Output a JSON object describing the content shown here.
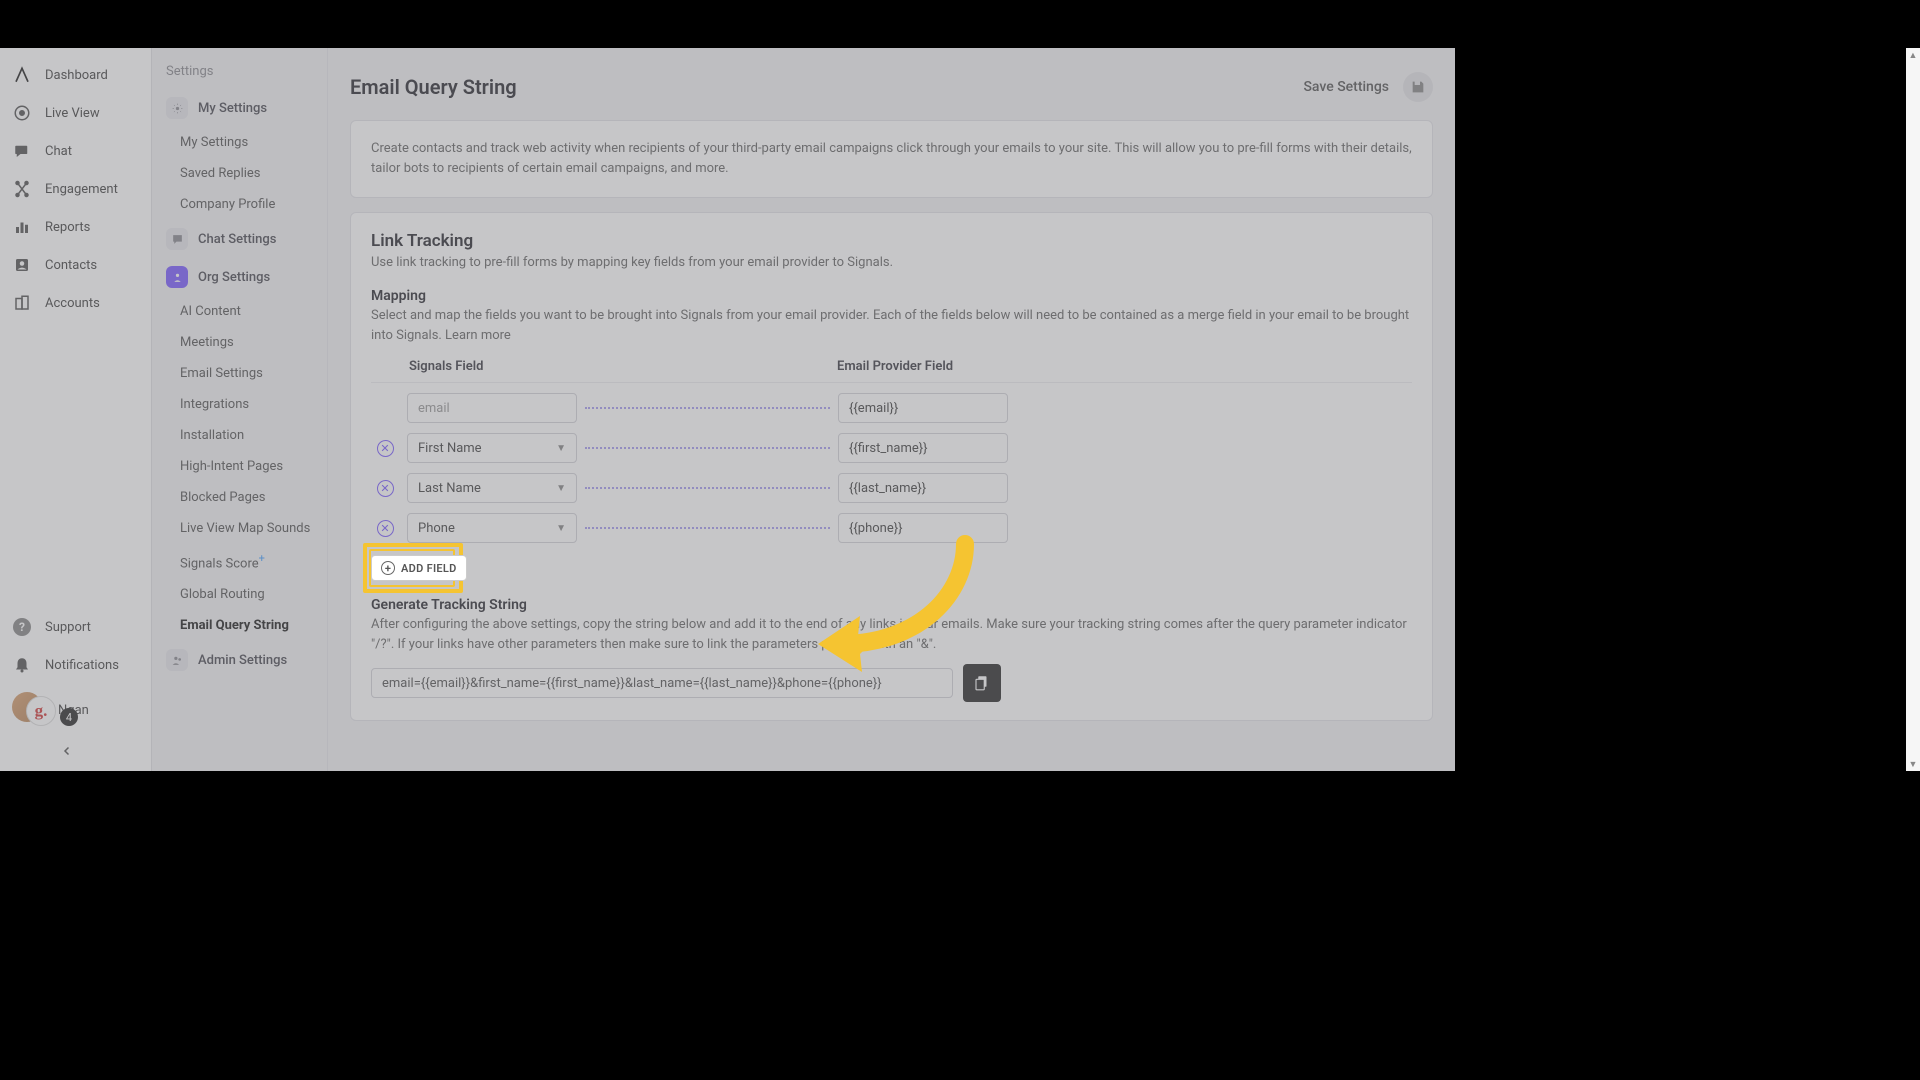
{
  "nav": {
    "items": [
      {
        "label": "Dashboard"
      },
      {
        "label": "Live View"
      },
      {
        "label": "Chat"
      },
      {
        "label": "Engagement"
      },
      {
        "label": "Reports"
      },
      {
        "label": "Contacts"
      },
      {
        "label": "Accounts"
      }
    ],
    "bottom": [
      {
        "label": "Support"
      },
      {
        "label": "Notifications"
      }
    ],
    "user": {
      "name": "Ngan",
      "badge": "4",
      "glyph": "g."
    }
  },
  "settings": {
    "heading": "Settings",
    "groups": {
      "my": {
        "label": "My Settings",
        "items": [
          "My Settings",
          "Saved Replies",
          "Company Profile"
        ]
      },
      "chat": {
        "label": "Chat Settings"
      },
      "org": {
        "label": "Org Settings",
        "items": [
          "AI Content",
          "Meetings",
          "Email Settings",
          "Integrations",
          "Installation",
          "High-Intent Pages",
          "Blocked Pages",
          "Live View Map Sounds",
          "Signals Score",
          "Global Routing",
          "Email Query String"
        ]
      },
      "admin": {
        "label": "Admin Settings"
      }
    }
  },
  "page": {
    "title": "Email Query String",
    "save_label": "Save Settings",
    "intro": "Create contacts and track web activity when recipients of your third-party email campaigns click through your emails to your site. This will allow you to pre-fill forms with their details, tailor bots to recipients of certain email campaigns, and more."
  },
  "link_tracking": {
    "title": "Link Tracking",
    "sub": "Use link tracking to pre-fill forms by mapping key fields from your email provider to Signals.",
    "mapping_title": "Mapping",
    "mapping_sub": "Select and map the fields you want to be brought into Signals from your email provider. Each of the fields below will need to be contained as a merge field in your email to be brought into Signals. Learn more",
    "col1": "Signals Field",
    "col2": "Email Provider Field",
    "rows": [
      {
        "signals": "email",
        "removable": false,
        "readonly": true,
        "provider": "{{email}}"
      },
      {
        "signals": "First Name",
        "removable": true,
        "readonly": false,
        "provider": "{{first_name}}"
      },
      {
        "signals": "Last Name",
        "removable": true,
        "readonly": false,
        "provider": "{{last_name}}"
      },
      {
        "signals": "Phone",
        "removable": true,
        "readonly": false,
        "provider": "{{phone}}"
      }
    ],
    "add_field": "ADD FIELD"
  },
  "generate": {
    "title": "Generate Tracking String",
    "sub": "After configuring the above settings, copy the string below and add it to the end of any links in your emails. Make sure your tracking string comes after the query parameter indicator \"/?\". If your links have other parameters then make sure to link the parameters properly with an \"&\".",
    "value": "email={{email}}&first_name={{first_name}}&last_name={{last_name}}&phone={{phone}}"
  }
}
